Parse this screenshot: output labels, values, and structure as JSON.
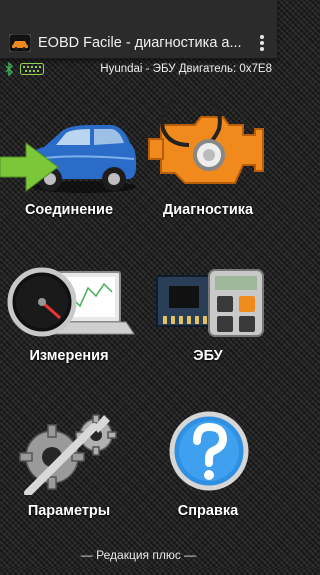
{
  "app": {
    "title": "EOBD Facile - диагностика а...",
    "icon": "obd-car-icon"
  },
  "status": {
    "bluetooth_icon": "bluetooth-icon",
    "adapter_icon": "obd-adapter-icon",
    "vehicle_info": "Hyundai - ЭБУ Двигатель: 0x7E8"
  },
  "menu": {
    "connection": "Соединение",
    "diagnostics": "Диагностика",
    "measurements": "Измерения",
    "ecu": "ЭБУ",
    "settings": "Параметры",
    "help": "Справка"
  },
  "footer": {
    "edition": "— Редакция плюс —"
  },
  "colors": {
    "background": "#262626",
    "bluetooth": "#3fae55",
    "adapter": "#8fd14f",
    "car": "#2a6cc8",
    "arrow": "#7cc63a",
    "engine": "#f08a1c",
    "help": "#2f8fe0"
  }
}
